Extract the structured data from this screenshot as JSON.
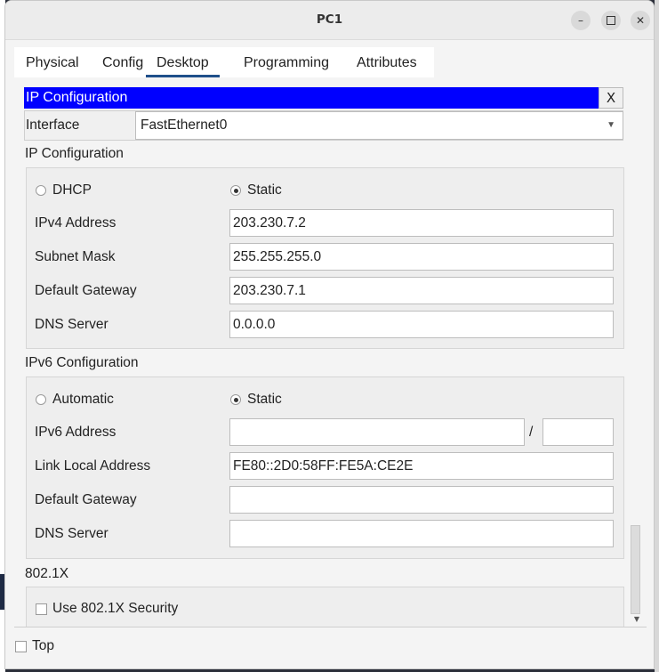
{
  "window": {
    "title": "PC1"
  },
  "window_controls": {
    "minimize": "–",
    "close": "✕"
  },
  "tabs": [
    {
      "label": "Physical",
      "active": false
    },
    {
      "label": "Config",
      "active": false
    },
    {
      "label": "Desktop",
      "active": true
    },
    {
      "label": "Programming",
      "active": false
    },
    {
      "label": "Attributes",
      "active": false
    }
  ],
  "panel": {
    "title": "IP Configuration",
    "close_label": "X"
  },
  "interface": {
    "label": "Interface",
    "value": "FastEthernet0"
  },
  "ipv4": {
    "section_title": "IP Configuration",
    "dhcp_label": "DHCP",
    "static_label": "Static",
    "mode": "Static",
    "address_label": "IPv4 Address",
    "address": "203.230.7.2",
    "mask_label": "Subnet Mask",
    "mask": "255.255.255.0",
    "gateway_label": "Default Gateway",
    "gateway": "203.230.7.1",
    "dns_label": "DNS Server",
    "dns": "0.0.0.0"
  },
  "ipv6": {
    "section_title": "IPv6 Configuration",
    "auto_label": "Automatic",
    "static_label": "Static",
    "mode": "Static",
    "address_label": "IPv6 Address",
    "address": "",
    "prefix_sep": "/",
    "prefix": "",
    "link_local_label": "Link Local Address",
    "link_local": "FE80::2D0:58FF:FE5A:CE2E",
    "gateway_label": "Default Gateway",
    "gateway": "",
    "dns_label": "DNS Server",
    "dns": ""
  },
  "dot1x": {
    "section_title": "802.1X",
    "use_label": "Use 802.1X Security",
    "checked": false
  },
  "footer": {
    "top_label": "Top",
    "checked": false
  },
  "colors": {
    "panel_header_bg": "#0000ff",
    "active_tab_underline": "#1f4f8a"
  }
}
